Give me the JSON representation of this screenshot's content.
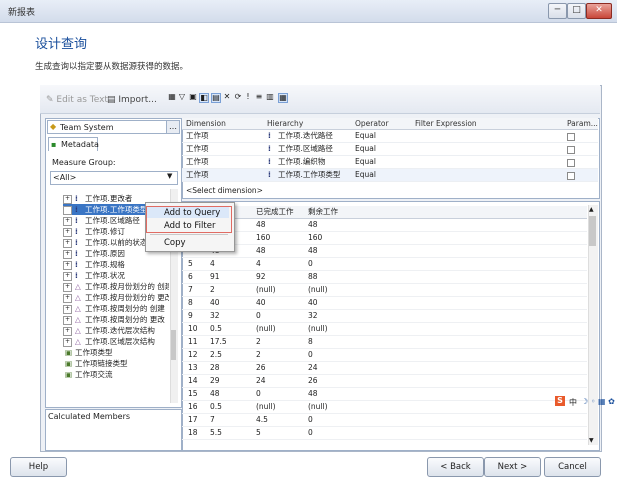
{
  "window": {
    "title": "新报表",
    "controls": [
      "─",
      "□",
      "✕"
    ]
  },
  "page": {
    "heading": "设计查询",
    "subtitle": "生成查询以指定要从数据源获得的数据。"
  },
  "toolbar": {
    "edit_as_text": "Edit as Text",
    "import": "Import..."
  },
  "left_pane": {
    "cube": "Team System",
    "metadata_tab": "Metadata",
    "measure_group_label": "Measure Group:",
    "measure_group_value": "<All>",
    "tree_items": [
      "工作项.更改者",
      "工作项.工作项类型",
      "工作项.区域路径",
      "工作项.修订",
      "工作项.以前的状态",
      "工作项.原因",
      "工作项.规格",
      "工作项.状况",
      "工作项.按月份划分的 创建",
      "工作项.按月份划分的 更改",
      "工作项.按周划分的 创建",
      "工作项.按周划分的 更改",
      "工作项.迭代层次结构",
      "工作项.区域层次结构",
      "工作项类型",
      "工作项链接类型",
      "工作项交流"
    ],
    "calculated_members": "Calculated Members"
  },
  "filter_grid": {
    "headers": [
      "Dimension",
      "Hierarchy",
      "Operator",
      "Filter Expression",
      "Param..."
    ],
    "rows": [
      {
        "dimension": "工作项",
        "hierarchy": "工作项.迭代路径",
        "operator": "Equal"
      },
      {
        "dimension": "工作项",
        "hierarchy": "工作项.区域路径",
        "operator": "Equal"
      },
      {
        "dimension": "工作项",
        "hierarchy": "工作项.编织物",
        "operator": "Equal"
      },
      {
        "dimension": "工作项",
        "hierarchy": "工作项.工作项类型",
        "operator": "Equal"
      }
    ],
    "select_dimension": "<Select dimension>"
  },
  "data_grid": {
    "headers": [
      "",
      "",
      "已完成工作",
      "剩余工作"
    ],
    "rows": [
      [
        "",
        "48",
        "48",
        "48"
      ],
      [
        "",
        "160",
        "160",
        "160"
      ],
      [
        "",
        "48",
        "48",
        "48"
      ],
      [
        "5",
        "4",
        "4",
        "0"
      ],
      [
        "6",
        "91",
        "92",
        "88"
      ],
      [
        "7",
        "2",
        "(null)",
        "(null)"
      ],
      [
        "8",
        "40",
        "40",
        "40"
      ],
      [
        "9",
        "32",
        "0",
        "32"
      ],
      [
        "10",
        "0.5",
        "(null)",
        "(null)"
      ],
      [
        "11",
        "17.5",
        "2",
        "8"
      ],
      [
        "12",
        "2.5",
        "2",
        "0"
      ],
      [
        "13",
        "28",
        "26",
        "24"
      ],
      [
        "14",
        "29",
        "24",
        "26"
      ],
      [
        "15",
        "48",
        "0",
        "48"
      ],
      [
        "16",
        "0.5",
        "(null)",
        "(null)"
      ],
      [
        "17",
        "7",
        "4.5",
        "0"
      ],
      [
        "18",
        "5.5",
        "5",
        "0"
      ]
    ]
  },
  "context_menu": {
    "items": [
      "Add to Query",
      "Add to Filter",
      "Copy"
    ]
  },
  "buttons": {
    "help": "Help",
    "back": "< Back",
    "next": "Next >",
    "cancel": "Cancel"
  },
  "ime": {
    "label": "中"
  },
  "colors": {
    "heading": "#1a4f9c",
    "menu_highlight_border": "#e06b63"
  }
}
